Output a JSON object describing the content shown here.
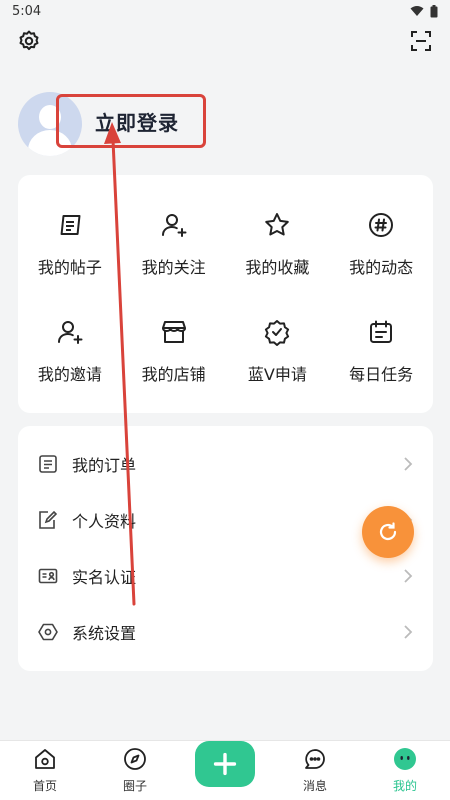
{
  "status_bar": {
    "time": "5:04"
  },
  "profile": {
    "login_label": "立即登录"
  },
  "grid": {
    "rows": [
      [
        {
          "label": "我的帖子",
          "icon": "post-icon"
        },
        {
          "label": "我的关注",
          "icon": "follow-icon"
        },
        {
          "label": "我的收藏",
          "icon": "star-icon"
        },
        {
          "label": "我的动态",
          "icon": "hashtag-icon"
        }
      ],
      [
        {
          "label": "我的邀请",
          "icon": "invite-icon"
        },
        {
          "label": "我的店铺",
          "icon": "store-icon"
        },
        {
          "label": "蓝V申请",
          "icon": "verified-badge-icon"
        },
        {
          "label": "每日任务",
          "icon": "calendar-icon"
        }
      ]
    ]
  },
  "list": {
    "items": [
      {
        "label": "我的订单",
        "icon": "order-icon"
      },
      {
        "label": "个人资料",
        "icon": "edit-profile-icon"
      },
      {
        "label": "实名认证",
        "icon": "id-card-icon"
      },
      {
        "label": "系统设置",
        "icon": "hexagon-settings-icon"
      }
    ]
  },
  "tabbar": {
    "items": [
      {
        "label": "首页",
        "icon": "home-icon"
      },
      {
        "label": "圈子",
        "icon": "compass-icon"
      },
      {
        "label": "",
        "icon": "plus-icon"
      },
      {
        "label": "消息",
        "icon": "message-icon"
      },
      {
        "label": "我的",
        "icon": "me-face-icon",
        "active": true
      }
    ]
  },
  "colors": {
    "accent": "#30c791",
    "annotation": "#d9433b",
    "fab": "#f8923a"
  }
}
